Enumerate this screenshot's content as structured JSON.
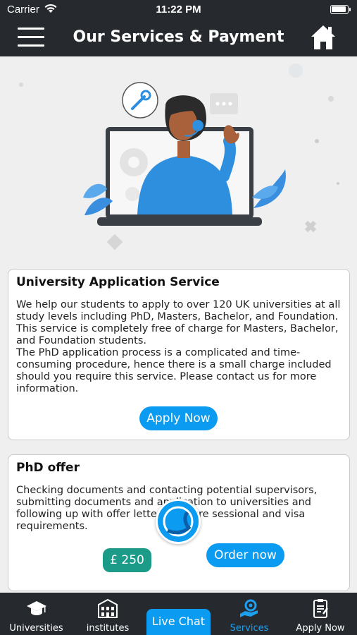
{
  "status_bar": {
    "carrier": "Carrier",
    "time": "11:22 PM"
  },
  "header": {
    "title": "Our Services & Payment",
    "menu_icon": "hamburger-icon",
    "home_icon": "home-icon"
  },
  "cards": [
    {
      "title": "University Application Service",
      "paragraphs": [
        "We help our students to apply to over 120 UK universities at all study levels including PhD, Masters, Bachelor, and Foundation. This service is completely free of charge for Masters, Bachelor, and Foundation students.",
        "The PhD application process is a complicated and time-consuming procedure, hence there is a small charge included should you require this service. Please contact us for more information."
      ],
      "button_label": "Apply Now"
    },
    {
      "title": "PhD offer",
      "paragraphs": [
        "Checking documents and contacting potential supervisors, submitting documents and application to universities and following up with offer letters and pre sessional and visa requirements."
      ],
      "price": "£ 250",
      "button_label": "Order now"
    }
  ],
  "tab_bar": {
    "live_chat": "Live Chat",
    "tabs": [
      {
        "label": "Universities",
        "icon": "graduation-cap-icon"
      },
      {
        "label": "institutes",
        "icon": "building-icon"
      },
      {
        "label": "Services",
        "icon": "services-icon",
        "active": true
      },
      {
        "label": "Apply Now",
        "icon": "application-form-icon"
      }
    ]
  },
  "colors": {
    "accent": "#0b9bf0",
    "header": "#262a2e",
    "price": "#1d9b89"
  }
}
